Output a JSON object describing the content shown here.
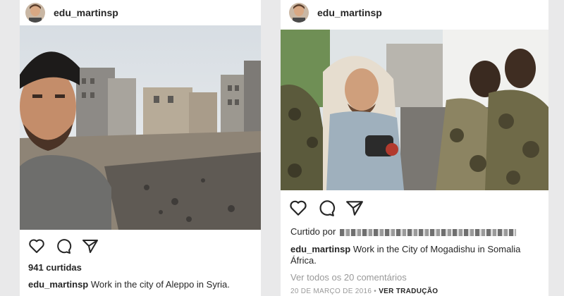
{
  "left_post": {
    "username": "edu_martinsp",
    "likes": "941 curtidas",
    "caption_user": "edu_martinsp",
    "caption_text": " Work in the city of Aleppo in Syria."
  },
  "right_post": {
    "username": "edu_martinsp",
    "liked_by_label": "Curtido por",
    "caption_user": "edu_martinsp",
    "caption_text": " Work in the City of Mogadishu in Somalia",
    "caption_text_cont": "África.",
    "view_comments": "Ver todos os 20 comentários",
    "date": "20 DE MARÇO DE 2016",
    "separator": "•",
    "translate": "VER TRADUÇÃO"
  },
  "icons": [
    "heart-icon",
    "comment-icon",
    "share-icon"
  ]
}
